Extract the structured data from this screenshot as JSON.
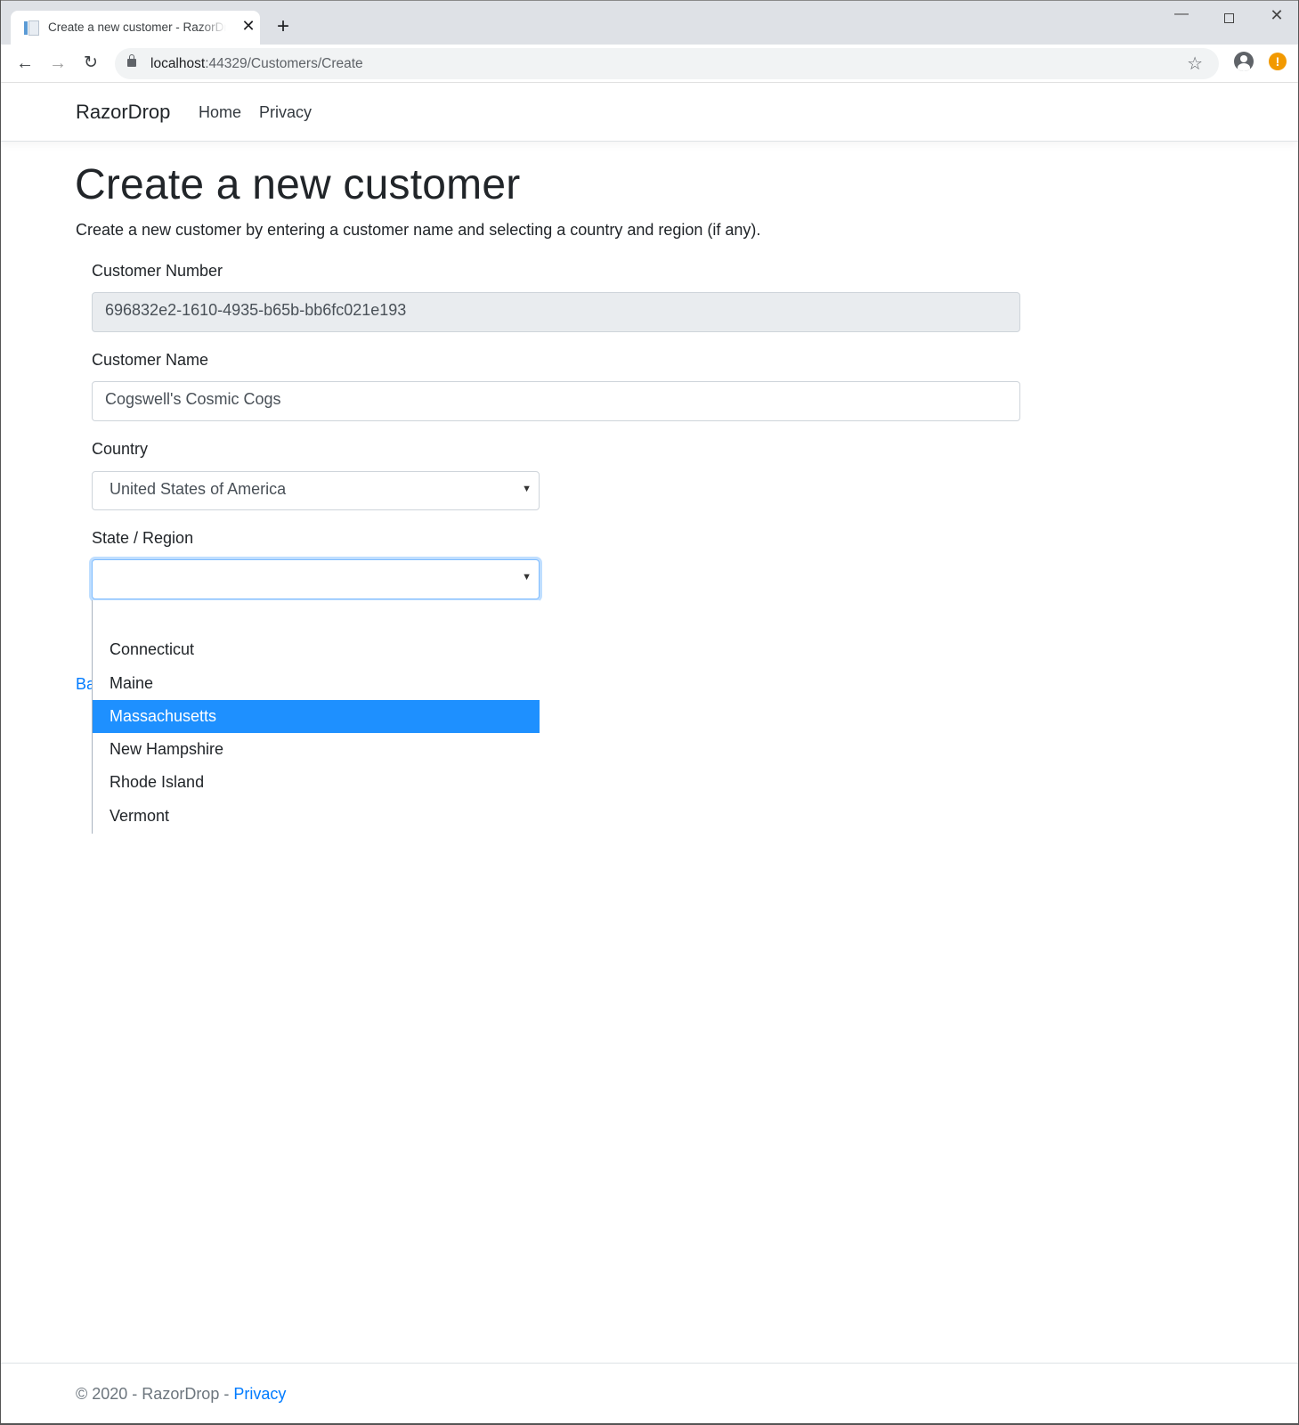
{
  "browser": {
    "tab_title": "Create a new customer - RazorDrop",
    "tab_close_glyph": "✕",
    "new_tab_glyph": "+",
    "window_controls": {
      "minimize": "—",
      "close": "✕"
    },
    "nav": {
      "back": "←",
      "forward": "→",
      "reload": "↻"
    },
    "url_host": "localhost",
    "url_rest": ":44329/Customers/Create",
    "star_glyph": "☆",
    "alert_glyph": "!"
  },
  "navbar": {
    "brand": "RazorDrop",
    "links": [
      "Home",
      "Privacy"
    ]
  },
  "main": {
    "title": "Create a new customer",
    "lead": "Create a new customer by entering a customer name and selecting a country and region (if any).",
    "customer_number": {
      "label": "Customer Number",
      "value": "696832e2-1610-4935-b65b-bb6fc021e193"
    },
    "customer_name": {
      "label": "Customer Name",
      "value": "Cogswell's Cosmic Cogs"
    },
    "country": {
      "label": "Country",
      "value": "United States of America"
    },
    "state_region": {
      "label": "State / Region",
      "value": "",
      "options": [
        "",
        "Connecticut",
        "Maine",
        "Massachusetts",
        "New Hampshire",
        "Rhode Island",
        "Vermont"
      ],
      "highlighted": "Massachusetts"
    },
    "caret_glyph": "▼",
    "back_link_visible": "Ba"
  },
  "footer": {
    "copyright": "© 2020 - RazorDrop - ",
    "privacy_link": "Privacy"
  },
  "colors": {
    "accent": "#007bff",
    "highlight": "#1e90ff",
    "readonly_bg": "#e9ecef",
    "focus_border": "#80bdff"
  }
}
